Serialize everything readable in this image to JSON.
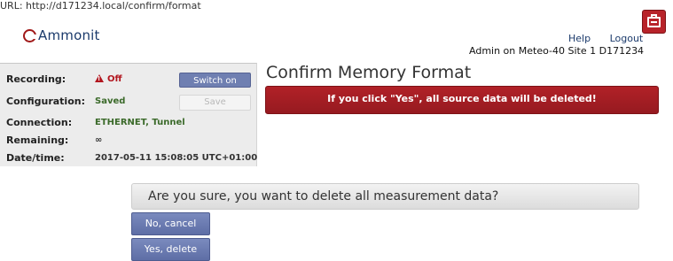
{
  "browser": {
    "url": "URL: http://d171234.local/confirm/format"
  },
  "header": {
    "logo_text": "Ammonit",
    "help": "Help",
    "logout": "Logout",
    "user_info": "Admin on Meteo-40 Site 1 D171234",
    "print_icon": "printer-icon"
  },
  "status": {
    "recording_label": "Recording:",
    "recording_value": "Off",
    "configuration_label": "Configuration:",
    "configuration_value": "Saved",
    "connection_label": "Connection:",
    "connection_value": "ETHERNET, Tunnel",
    "remaining_label": "Remaining:",
    "remaining_value": "∞",
    "datetime_label": "Date/time:",
    "datetime_value": "2017-05-11 15:08:05 UTC+01:00",
    "switch_on_label": "Switch on",
    "save_label": "Save"
  },
  "main": {
    "title": "Confirm Memory Format",
    "alert": "If you click \"Yes\", all source data will be deleted!",
    "question": "Are you sure, you want to delete all measurement data?",
    "cancel_label": "No, cancel",
    "confirm_label": "Yes, delete"
  },
  "colors": {
    "alert": "#a61d24",
    "button": "#6f7fb1",
    "status_ok": "#3b6a2a",
    "status_off": "#b2161f"
  }
}
